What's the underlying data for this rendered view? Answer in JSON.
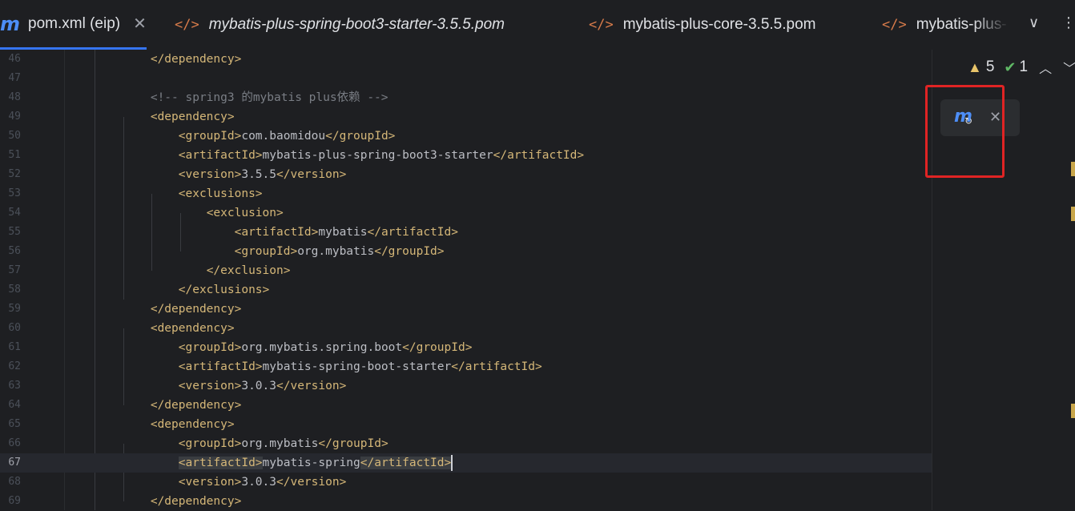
{
  "tabs": [
    {
      "label": "pom.xml (eip)",
      "icon": "maven-m-icon",
      "active": true,
      "closable": true
    },
    {
      "label": "mybatis-plus-spring-boot3-starter-3.5.5.pom",
      "icon": "xml-code-icon",
      "active": false
    },
    {
      "label": "mybatis-plus-core-3.5.5.pom",
      "icon": "xml-code-icon",
      "active": false
    },
    {
      "label": "mybatis-plus-",
      "icon": "xml-code-icon",
      "active": false
    }
  ],
  "toolbar": {
    "dropdown_glyph": "∨",
    "more_glyph": "⋮"
  },
  "inspections": {
    "warnings": "5",
    "ok": "1"
  },
  "maven_popup": {
    "icon": "maven-reload-icon",
    "close_glyph": "✕"
  },
  "colors": {
    "accent": "#3574f0",
    "tag": "#d5b778",
    "text": "#bcbec4",
    "comment": "#7a7e85",
    "highlight_box": "#e02424",
    "warning": "#e8c46a"
  },
  "editor": {
    "current_line": "67",
    "lines": [
      {
        "num": "46",
        "indent": "        ",
        "parts": [
          [
            "t",
            "</dependency>"
          ]
        ]
      },
      {
        "num": "47",
        "indent": "",
        "parts": []
      },
      {
        "num": "48",
        "indent": "        ",
        "parts": [
          [
            "c",
            "<!-- spring3 的mybatis plus依赖 -->"
          ]
        ]
      },
      {
        "num": "49",
        "indent": "        ",
        "parts": [
          [
            "t",
            "<dependency>"
          ]
        ]
      },
      {
        "num": "50",
        "indent": "            ",
        "parts": [
          [
            "t",
            "<groupId>"
          ],
          [
            "x",
            "com.baomidou"
          ],
          [
            "t",
            "</groupId>"
          ]
        ]
      },
      {
        "num": "51",
        "indent": "            ",
        "parts": [
          [
            "t",
            "<artifactId>"
          ],
          [
            "x",
            "mybatis-plus-spring-boot3-starter"
          ],
          [
            "t",
            "</artifactId>"
          ]
        ]
      },
      {
        "num": "52",
        "indent": "            ",
        "parts": [
          [
            "t",
            "<version>"
          ],
          [
            "x",
            "3.5.5"
          ],
          [
            "t",
            "</version>"
          ]
        ]
      },
      {
        "num": "53",
        "indent": "            ",
        "parts": [
          [
            "t",
            "<exclusions>"
          ]
        ]
      },
      {
        "num": "54",
        "indent": "                ",
        "parts": [
          [
            "t",
            "<exclusion>"
          ]
        ]
      },
      {
        "num": "55",
        "indent": "                    ",
        "parts": [
          [
            "t",
            "<artifactId>"
          ],
          [
            "x",
            "mybatis"
          ],
          [
            "t",
            "</artifactId>"
          ]
        ]
      },
      {
        "num": "56",
        "indent": "                    ",
        "parts": [
          [
            "t",
            "<groupId>"
          ],
          [
            "x",
            "org.mybatis"
          ],
          [
            "t",
            "</groupId>"
          ]
        ]
      },
      {
        "num": "57",
        "indent": "                ",
        "parts": [
          [
            "t",
            "</exclusion>"
          ]
        ]
      },
      {
        "num": "58",
        "indent": "            ",
        "parts": [
          [
            "t",
            "</exclusions>"
          ]
        ]
      },
      {
        "num": "59",
        "indent": "        ",
        "parts": [
          [
            "t",
            "</dependency>"
          ]
        ]
      },
      {
        "num": "60",
        "indent": "        ",
        "parts": [
          [
            "t",
            "<dependency>"
          ]
        ]
      },
      {
        "num": "61",
        "indent": "            ",
        "parts": [
          [
            "t",
            "<groupId>"
          ],
          [
            "x",
            "org.mybatis.spring.boot"
          ],
          [
            "t",
            "</groupId>"
          ]
        ]
      },
      {
        "num": "62",
        "indent": "            ",
        "parts": [
          [
            "t",
            "<artifactId>"
          ],
          [
            "x",
            "mybatis-spring-boot-starter"
          ],
          [
            "t",
            "</artifactId>"
          ]
        ]
      },
      {
        "num": "63",
        "indent": "            ",
        "parts": [
          [
            "t",
            "<version>"
          ],
          [
            "x",
            "3.0.3"
          ],
          [
            "t",
            "</version>"
          ]
        ]
      },
      {
        "num": "64",
        "indent": "        ",
        "parts": [
          [
            "t",
            "</dependency>"
          ]
        ]
      },
      {
        "num": "65",
        "indent": "        ",
        "parts": [
          [
            "t",
            "<dependency>"
          ]
        ]
      },
      {
        "num": "66",
        "indent": "            ",
        "parts": [
          [
            "t",
            "<groupId>"
          ],
          [
            "x",
            "org.mybatis"
          ],
          [
            "t",
            "</groupId>"
          ]
        ]
      },
      {
        "num": "67",
        "indent": "            ",
        "parts": [
          [
            "th",
            "<artifactId>"
          ],
          [
            "x",
            "mybatis-spring"
          ],
          [
            "th",
            "</artifactId>"
          ]
        ]
      },
      {
        "num": "68",
        "indent": "            ",
        "parts": [
          [
            "t",
            "<version>"
          ],
          [
            "x",
            "3.0.3"
          ],
          [
            "t",
            "</version>"
          ]
        ]
      },
      {
        "num": "69",
        "indent": "        ",
        "parts": [
          [
            "t",
            "</dependency>"
          ]
        ]
      }
    ]
  }
}
